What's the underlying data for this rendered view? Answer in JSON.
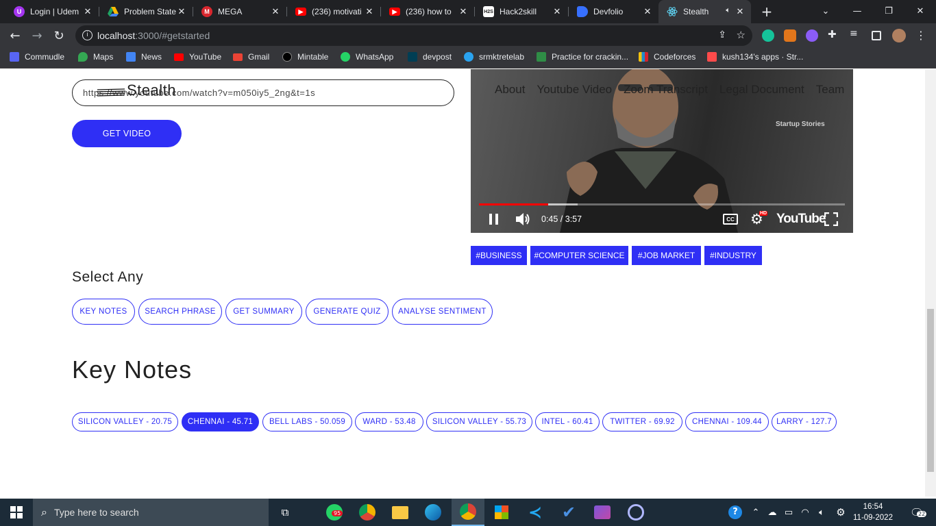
{
  "browser": {
    "tabs": [
      {
        "title": "Login | Udem",
        "icon": "udemy-icon",
        "color": "#a435f0"
      },
      {
        "title": "Problem State",
        "icon": "google-drive-icon",
        "color": "#1fa463"
      },
      {
        "title": "MEGA",
        "icon": "mega-icon",
        "color": "#d9272e"
      },
      {
        "title": "(236) motivati",
        "icon": "youtube-icon",
        "color": "#ff0000"
      },
      {
        "title": "(236) how to ",
        "icon": "youtube-icon",
        "color": "#ff0000"
      },
      {
        "title": "Hack2skill",
        "icon": "hack2skill-icon",
        "color": "#ffffff"
      },
      {
        "title": "Devfolio",
        "icon": "devfolio-icon",
        "color": "#3770ff"
      },
      {
        "title": "Stealth",
        "icon": "react-icon",
        "color": "#61dafb",
        "active": true
      }
    ],
    "new_tab": "+",
    "url_host": "localhost",
    "url_path": ":3000/#getstarted",
    "bookmarks": [
      {
        "label": "Commudle",
        "color": "#5865f2"
      },
      {
        "label": "Maps",
        "color": "#34a853"
      },
      {
        "label": "News",
        "color": "#4285f4"
      },
      {
        "label": "YouTube",
        "color": "#ff0000"
      },
      {
        "label": "Gmail",
        "color": "#ea4335"
      },
      {
        "label": "Mintable",
        "color": "#000000"
      },
      {
        "label": "WhatsApp",
        "color": "#25d366"
      },
      {
        "label": "devpost",
        "color": "#003e54"
      },
      {
        "label": "srmktretelab",
        "color": "#2aa3ef"
      },
      {
        "label": "Practice for crackin...",
        "color": "#2f8d46"
      },
      {
        "label": "Codeforces",
        "color": "#f4c20d"
      },
      {
        "label": "kush134's apps · Str...",
        "color": "#ff4b4b"
      }
    ]
  },
  "page": {
    "logo": "Stealth",
    "url_input_value": "https://www.youtube.com/watch?v=m050iy5_2ng&t=1s",
    "get_video_label": "GET VIDEO",
    "nav": [
      "About",
      "Youtube Video",
      "Zoom Transcript",
      "Legal Document",
      "Team"
    ],
    "video": {
      "overlay_label": "Startup Stories",
      "time": "0:45 / 3:57",
      "played_fraction": 0.19,
      "loaded_fraction": 0.27,
      "brand": "YouTube",
      "hd_badge": "HD"
    },
    "tags": [
      "#BUSINESS",
      "#COMPUTER SCIENCE",
      "#JOB MARKET",
      "#INDUSTRY"
    ],
    "select_any_label": "Select Any",
    "options": [
      "KEY NOTES",
      "SEARCH PHRASE",
      "GET SUMMARY",
      "GENERATE QUIZ",
      "ANALYSE SENTIMENT"
    ],
    "key_notes_title": "Key Notes",
    "key_notes": [
      {
        "label": "SILICON VALLEY - 20.75",
        "active": false
      },
      {
        "label": "CHENNAI - 45.71",
        "active": true
      },
      {
        "label": "BELL LABS - 50.059",
        "active": false
      },
      {
        "label": "WARD - 53.48",
        "active": false
      },
      {
        "label": "SILICON VALLEY - 55.73",
        "active": false
      },
      {
        "label": "INTEL - 60.41",
        "active": false
      },
      {
        "label": "TWITTER - 69.92",
        "active": false
      },
      {
        "label": "CHENNAI - 109.44",
        "active": false
      },
      {
        "label": "LARRY - 127.7",
        "active": false
      }
    ],
    "accent_color": "#2f2ff5"
  },
  "taskbar": {
    "search_placeholder": "Type here to search",
    "whatsapp_badge": "95",
    "time": "16:54",
    "date": "11-09-2022",
    "notifications": "22"
  }
}
